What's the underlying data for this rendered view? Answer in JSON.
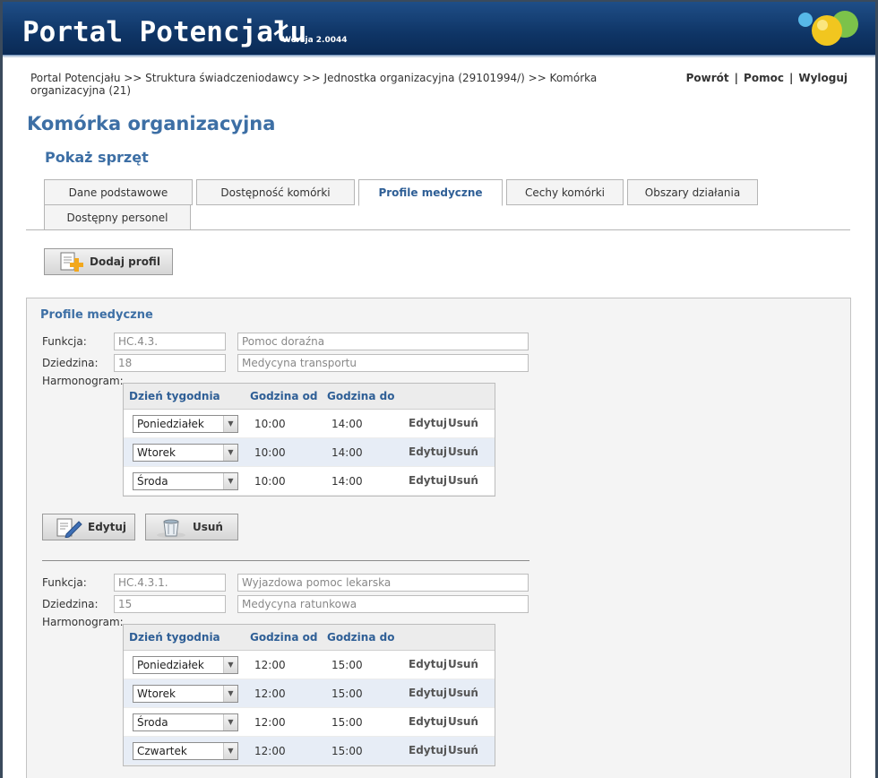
{
  "header": {
    "title": "Portal Potencjału",
    "version": "Wersja 2.0044"
  },
  "breadcrumb": "Portal Potencjału >> Struktura świadczeniodawcy >> Jednostka organizacyjna (29101994/) >> Komórka organizacyjna (21)",
  "top_links": {
    "back": "Powrót",
    "help": "Pomoc",
    "logout": "Wyloguj",
    "separator": "|"
  },
  "page_title": "Komórka organizacyjna",
  "sub_title": "Pokaż sprzęt",
  "tabs": [
    {
      "label": "Dane podstawowe"
    },
    {
      "label": "Dostępność komórki"
    },
    {
      "label": "Profile medyczne"
    },
    {
      "label": "Cechy komórki"
    },
    {
      "label": "Obszary działania"
    },
    {
      "label": "Dostępny personel"
    }
  ],
  "add_profile_button": "Dodaj profil",
  "section_title": "Profile medyczne",
  "labels": {
    "function": "Funkcja:",
    "domain": "Dziedzina:",
    "schedule": "Harmonogram:"
  },
  "grid_headers": {
    "day": "Dzień tygodnia",
    "from": "Godzina od",
    "to": "Godzina do"
  },
  "row_actions": {
    "edit": "Edytuj",
    "delete": "Usuń"
  },
  "profile_buttons": {
    "edit": "Edytuj",
    "delete": "Usuń"
  },
  "profiles": [
    {
      "function_code": "HC.4.3.",
      "function_name": "Pomoc doraźna",
      "domain_code": "18",
      "domain_name": "Medycyna transportu",
      "schedule": [
        {
          "day": "Poniedziałek",
          "from": "10:00",
          "to": "14:00"
        },
        {
          "day": "Wtorek",
          "from": "10:00",
          "to": "14:00"
        },
        {
          "day": "Środa",
          "from": "10:00",
          "to": "14:00"
        }
      ]
    },
    {
      "function_code": "HC.4.3.1.",
      "function_name": "Wyjazdowa pomoc lekarska",
      "domain_code": "15",
      "domain_name": "Medycyna ratunkowa",
      "schedule": [
        {
          "day": "Poniedziałek",
          "from": "12:00",
          "to": "15:00"
        },
        {
          "day": "Wtorek",
          "from": "12:00",
          "to": "15:00"
        },
        {
          "day": "Środa",
          "from": "12:00",
          "to": "15:00"
        },
        {
          "day": "Czwartek",
          "from": "12:00",
          "to": "15:00"
        }
      ]
    }
  ]
}
